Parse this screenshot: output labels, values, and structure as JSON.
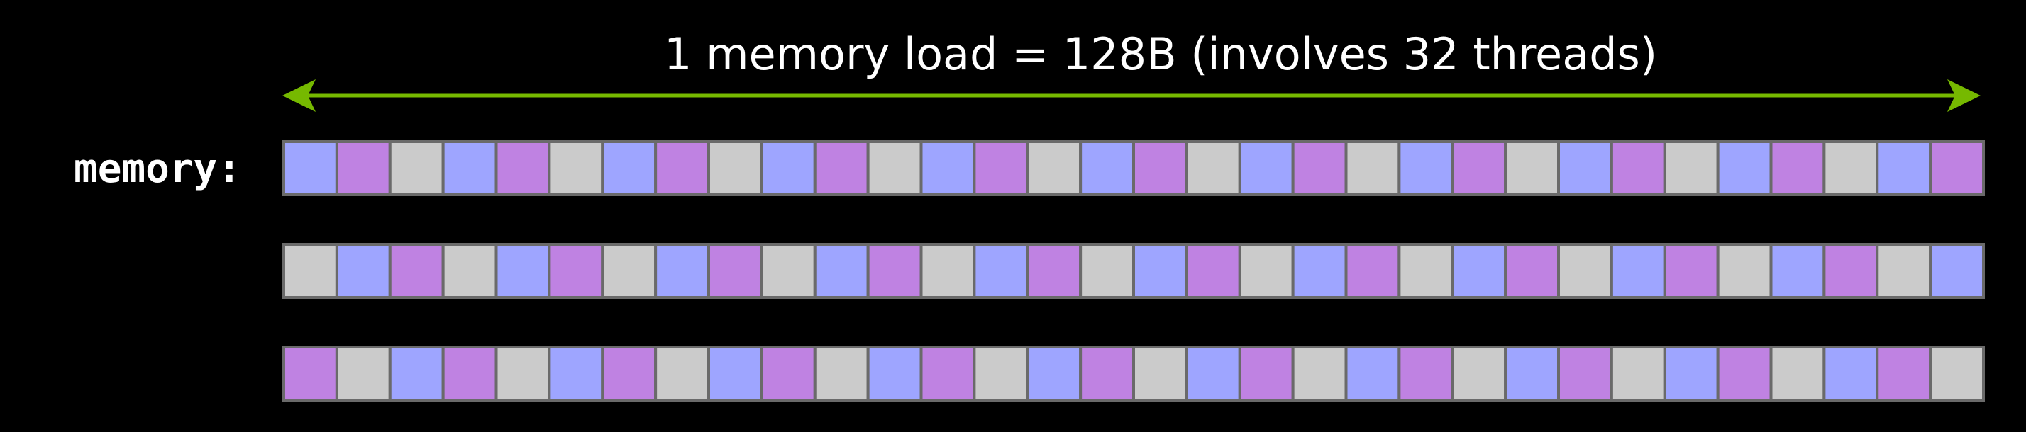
{
  "title": "1 memory load = 128B (involves 32 threads)",
  "row_label": "memory:",
  "colors": {
    "background": "#000000",
    "arrow": "#76b900",
    "text": "#ffffff",
    "cell_border": "#6a6a6a",
    "blue": "#9ea5ff",
    "purple": "#bf82e2",
    "gray": "#cbcbcb"
  },
  "rows": [
    {
      "cells": [
        "blue",
        "purple",
        "gray",
        "blue",
        "purple",
        "gray",
        "blue",
        "purple",
        "gray",
        "blue",
        "purple",
        "gray",
        "blue",
        "purple",
        "gray",
        "blue",
        "purple",
        "gray",
        "blue",
        "purple",
        "gray",
        "blue",
        "purple",
        "gray",
        "blue",
        "purple",
        "gray",
        "blue",
        "purple",
        "gray",
        "blue",
        "purple"
      ]
    },
    {
      "cells": [
        "gray",
        "blue",
        "purple",
        "gray",
        "blue",
        "purple",
        "gray",
        "blue",
        "purple",
        "gray",
        "blue",
        "purple",
        "gray",
        "blue",
        "purple",
        "gray",
        "blue",
        "purple",
        "gray",
        "blue",
        "purple",
        "gray",
        "blue",
        "purple",
        "gray",
        "blue",
        "purple",
        "gray",
        "blue",
        "purple",
        "gray",
        "blue"
      ]
    },
    {
      "cells": [
        "purple",
        "gray",
        "blue",
        "purple",
        "gray",
        "blue",
        "purple",
        "gray",
        "blue",
        "purple",
        "gray",
        "blue",
        "purple",
        "gray",
        "blue",
        "purple",
        "gray",
        "blue",
        "purple",
        "gray",
        "blue",
        "purple",
        "gray",
        "blue",
        "purple",
        "gray",
        "blue",
        "purple",
        "gray",
        "blue",
        "purple",
        "gray"
      ]
    }
  ]
}
